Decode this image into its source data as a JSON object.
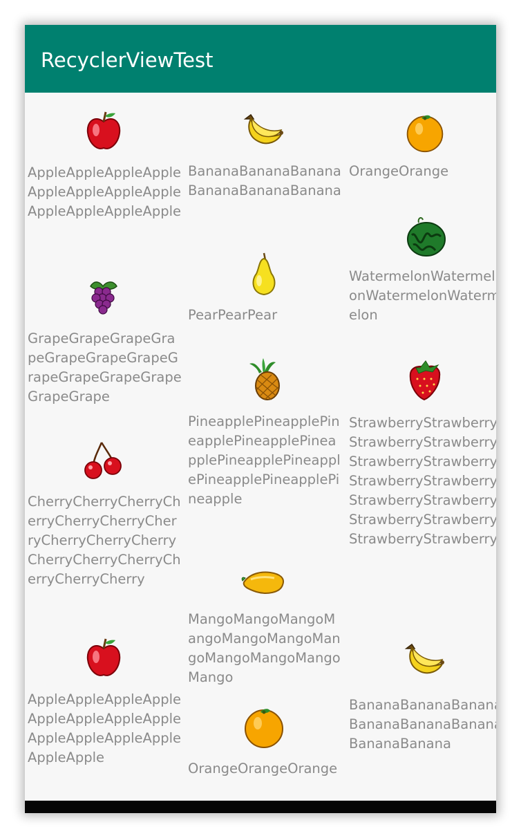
{
  "app_bar": {
    "title": "RecyclerViewTest"
  },
  "columns": [
    [
      {
        "label": "AppleAppleAppleAppleAppleAppleAppleAppleAppleAppleAppleApple",
        "icon": "apple-icon"
      },
      {
        "label": "GrapeGrapeGrapeGrapeGrapeGrapeGrapeGrapeGrapeGrapeGrapeGrapeGrape",
        "icon": "grape-icon"
      },
      {
        "label": "CherryCherryCherryCherryCherryCherryCherryCherryCherryCherryCherryCherryCherryCherryCherryCherry",
        "icon": "cherry-icon"
      },
      {
        "label": "AppleAppleAppleAppleAppleAppleAppleAppleAppleAppleAppleAppleAppleApple",
        "icon": "apple-icon"
      }
    ],
    [
      {
        "label": "BananaBananaBananaBananaBananaBanana",
        "icon": "banana-icon"
      },
      {
        "label": "PearPearPear",
        "icon": "pear-icon"
      },
      {
        "label": "PineapplePineapplePineapplePineapplePineapplePineapplePineapplePineapplePineapplePineapple",
        "icon": "pineapple-icon"
      },
      {
        "label": "MangoMangoMangoMangoMangoMangoMangoMangoMangoMangoMango",
        "icon": "mango-icon"
      },
      {
        "label": "OrangeOrangeOrange",
        "icon": "orange-icon"
      }
    ],
    [
      {
        "label": "OrangeOrange",
        "icon": "orange-icon"
      },
      {
        "label": "WatermelonWatermelonWatermelonWatermelon",
        "icon": "watermelon-icon"
      },
      {
        "label": "StrawberryStrawberryStrawberryStrawberryStrawberryStrawberryStrawberryStrawberryStrawberryStrawberryStrawberryStrawberryStrawberryStrawberry",
        "icon": "strawberry-icon"
      },
      {
        "label": "BananaBananaBananaBananaBananaBananaBananaBanana",
        "icon": "banana-icon"
      }
    ]
  ],
  "colors": {
    "app_bar": "#00806f",
    "label_text": "#8a8a8a",
    "background": "#f7f7f7"
  }
}
